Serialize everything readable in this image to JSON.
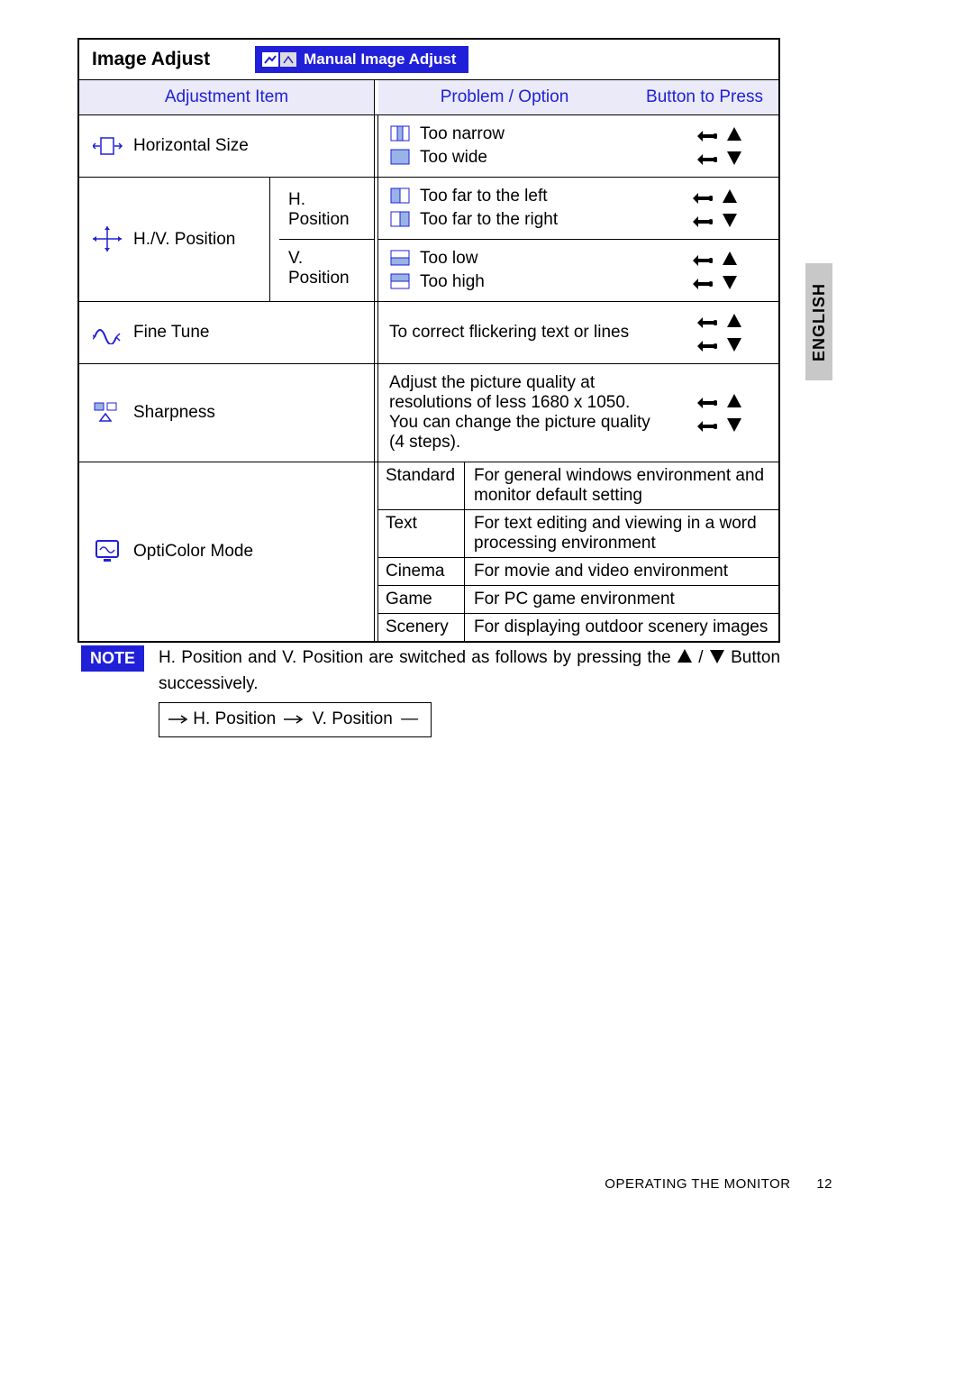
{
  "title": "Image Adjust",
  "badge": "Manual Image Adjust",
  "headers": {
    "adjustment": "Adjustment Item",
    "problem": "Problem / Option",
    "button": "Button to Press"
  },
  "rows": {
    "hsize": {
      "name": "Horizontal Size",
      "opts": [
        "Too narrow",
        "Too wide"
      ]
    },
    "hvpos": {
      "name": "H./V. Position",
      "hp_label": "H. Position",
      "vp_label": "V. Position",
      "hp_opts": [
        "Too far to the left",
        "Too far to the right"
      ],
      "vp_opts": [
        "Too low",
        "Too high"
      ]
    },
    "fine": {
      "name": "Fine Tune",
      "desc": "To correct flickering text or lines"
    },
    "sharp": {
      "name": "Sharpness",
      "desc": "Adjust the picture quality at resolutions of less 1680 x 1050.\nYou can change the picture quality (4 steps)."
    },
    "opti": {
      "name": "OptiColor Mode",
      "modes": [
        {
          "k": "Standard",
          "v": "For general windows environment and monitor default setting"
        },
        {
          "k": "Text",
          "v": "For text editing and viewing in a word processing environment"
        },
        {
          "k": "Cinema",
          "v": "For movie and video environment"
        },
        {
          "k": "Game",
          "v": "For PC game environment"
        },
        {
          "k": "Scenery",
          "v": "For displaying outdoor scenery images"
        }
      ]
    }
  },
  "note": {
    "label": "NOTE",
    "text_a": "H. Position and V. Position are switched as follows by pressing the ",
    "text_b": " Button successively.",
    "seq_a": "H. Position",
    "seq_b": "V. Position"
  },
  "side_tab": "ENGLISH",
  "footer": {
    "section": "OPERATING THE MONITOR",
    "page": "12"
  }
}
